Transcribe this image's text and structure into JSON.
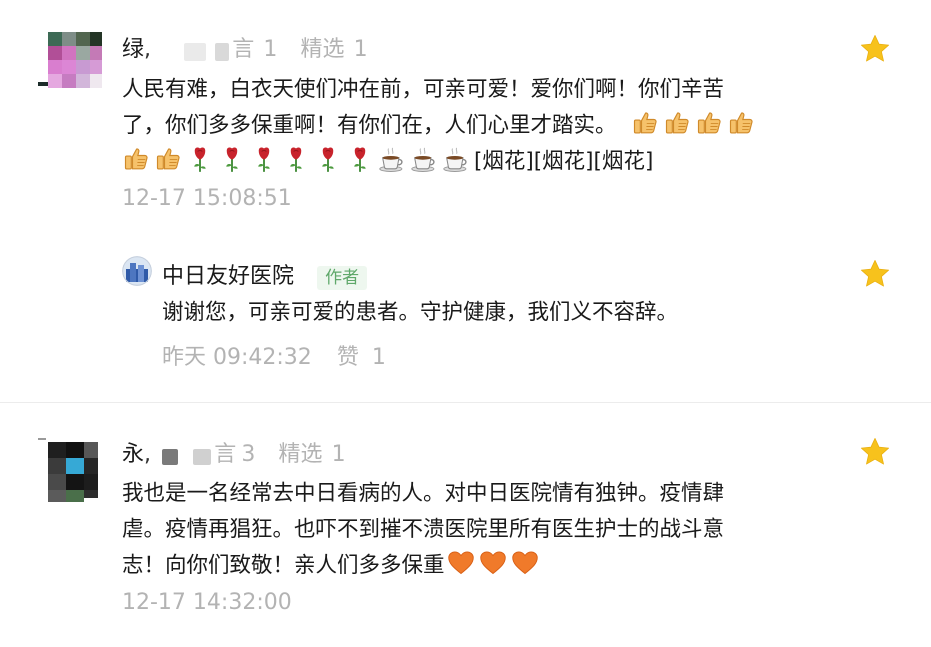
{
  "comments": [
    {
      "username": "绿",
      "username_tail": "言",
      "likes": "1",
      "featured_label": "精选",
      "featured_count": "1",
      "text_line1": "人民有难，白衣天使们冲在前，可亲可爱！爱你们啊！你们辛苦",
      "text_line2": "了，你们多多保重啊！有你们在，人们心里才踏实。",
      "text_line3_tail": "[烟花][烟花][烟花]",
      "timestamp": "12-17 15:08:51",
      "icons": [
        "thumbs-up-icon",
        "rose-icon",
        "coffee-cup-icon"
      ],
      "reply": {
        "author": "中日友好医院",
        "author_tag": "作者",
        "text": "谢谢您，可亲可爱的患者。守护健康，我们义不容辞。",
        "timestamp": "昨天 09:42:32",
        "like_label": "赞",
        "like_count": "1"
      }
    },
    {
      "username": "永",
      "username_tail": "言",
      "likes": "3",
      "featured_label": "精选",
      "featured_count": "1",
      "text_line1": "我也是一名经常去中日看病的人。对中日医院情有独钟。疫情肆",
      "text_line2": "虐。疫情再猖狂。也吓不到摧不溃医院里所有医生护士的战斗意",
      "text_line3": "志！向你们致敬！亲人们多多保重",
      "timestamp": "12-17 14:32:00",
      "icons": [
        "orange-heart-icon"
      ]
    }
  ],
  "colors": {
    "star": "#f7c21c",
    "meta": "#b3b3b3",
    "author_tag": "#5fa86a",
    "thumb": "#f6c26b",
    "rose": "#c8232c",
    "heart": "#f07a2a"
  }
}
